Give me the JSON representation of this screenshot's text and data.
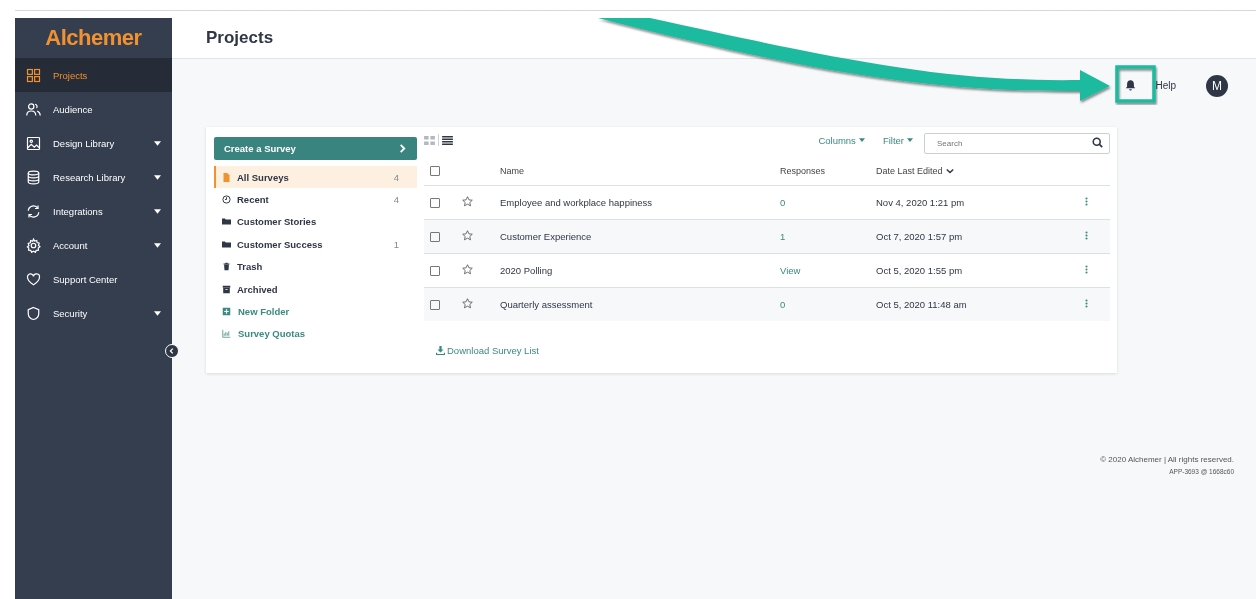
{
  "logo": "Alchemer",
  "sidebar": {
    "items": [
      {
        "label": "Projects",
        "kind": "grid",
        "selected": true,
        "has_menu": false
      },
      {
        "label": "Audience",
        "kind": "people",
        "selected": false,
        "has_menu": false
      },
      {
        "label": "Design Library",
        "kind": "image",
        "selected": false,
        "has_menu": true
      },
      {
        "label": "Research Library",
        "kind": "database",
        "selected": false,
        "has_menu": true
      },
      {
        "label": "Integrations",
        "kind": "sync",
        "selected": false,
        "has_menu": true
      },
      {
        "label": "Account",
        "kind": "gear",
        "selected": false,
        "has_menu": true
      },
      {
        "label": "Support Center",
        "kind": "heart",
        "selected": false,
        "has_menu": false
      },
      {
        "label": "Security",
        "kind": "shield",
        "selected": false,
        "has_menu": true
      }
    ]
  },
  "page_title": "Projects",
  "top_bar": {
    "help": "Help",
    "avatar": "M"
  },
  "create_button": "Create a Survey",
  "folders": [
    {
      "label": "All Surveys",
      "kind": "file",
      "count": "4",
      "selected": true
    },
    {
      "label": "Recent",
      "kind": "clock",
      "count": "4",
      "selected": false
    },
    {
      "label": "Customer Stories",
      "kind": "folder",
      "selected": false
    },
    {
      "label": "Customer Success",
      "kind": "folder",
      "count": "1",
      "selected": false
    },
    {
      "label": "Trash",
      "kind": "trash",
      "selected": false
    },
    {
      "label": "Archived",
      "kind": "archive",
      "selected": false
    }
  ],
  "folder_actions": [
    {
      "label": "New Folder",
      "kind": "plus"
    },
    {
      "label": "Survey Quotas",
      "kind": "chart"
    }
  ],
  "toolbar": {
    "columns": "Columns",
    "filter": "Filter",
    "search_placeholder": "Search"
  },
  "table": {
    "all_checked": false,
    "columns": [
      "Name",
      "Responses",
      "Date Last Edited"
    ],
    "rows": [
      {
        "checked": false,
        "starred": false,
        "name": "Employee and workplace happiness",
        "responses": "0",
        "date": "Nov 4, 2020 1:21 pm"
      },
      {
        "checked": false,
        "starred": false,
        "name": "Customer Experience",
        "responses": "1",
        "date": "Oct 7, 2020 1:57 pm"
      },
      {
        "checked": false,
        "starred": false,
        "name": "2020 Polling",
        "responses": "View",
        "date": "Oct 5, 2020 1:55 pm"
      },
      {
        "checked": false,
        "starred": false,
        "name": "Quarterly assessment",
        "responses": "0",
        "date": "Oct 5, 2020 11:48 am"
      }
    ]
  },
  "download_link": "Download Survey List",
  "footer": {
    "copyright": "© 2020 Alchemer | All rights reserved.",
    "build": "APP-3693 @ 1668c60"
  }
}
